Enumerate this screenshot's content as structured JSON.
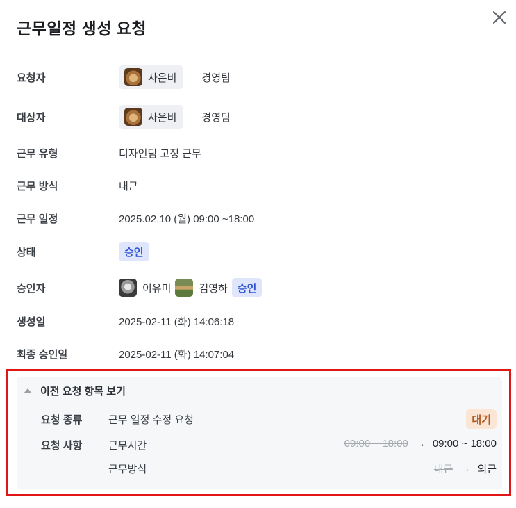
{
  "modal": {
    "title": "근무일정 생성 요청",
    "close_icon": "close-icon"
  },
  "fields": {
    "requester": {
      "label": "요청자",
      "name": "사은비",
      "dept": "경영팀"
    },
    "target": {
      "label": "대상자",
      "name": "사은비",
      "dept": "경영팀"
    },
    "work_type": {
      "label": "근무 유형",
      "value": "디자인팀 고정 근무"
    },
    "work_method": {
      "label": "근무 방식",
      "value": "내근"
    },
    "work_schedule": {
      "label": "근무 일정",
      "value": "2025.02.10 (월) 09:00 ~18:00"
    },
    "status": {
      "label": "상태",
      "value": "승인"
    },
    "approvers": {
      "label": "승인자",
      "list": [
        {
          "name": "이유미"
        },
        {
          "name": "김영하"
        }
      ],
      "status": "승인"
    },
    "created": {
      "label": "생성일",
      "value": "2025-02-11 (화) 14:06:18"
    },
    "final_approved": {
      "label": "최종 승인일",
      "value": "2025-02-11 (화) 14:07:04"
    }
  },
  "history": {
    "toggle_label": "이전 요청 항목 보기",
    "request_type": {
      "label": "요청 종류",
      "value": "근무 일정 수정 요청",
      "status": "대기"
    },
    "request_detail": {
      "label": "요청 사항",
      "items": [
        {
          "name": "근무시간",
          "old": "09:00 ~ 18:00",
          "arrow": "→",
          "new": "09:00 ~ 18:00"
        },
        {
          "name": "근무방식",
          "old": "내근",
          "arrow": "→",
          "new": "외근"
        }
      ]
    }
  },
  "colors": {
    "approve_badge_bg": "#dfe6fb",
    "approve_badge_text": "#2f55d4",
    "wait_badge_bg": "#fbe6d6",
    "wait_badge_text": "#b15a1f",
    "highlight_border": "#e01616"
  }
}
